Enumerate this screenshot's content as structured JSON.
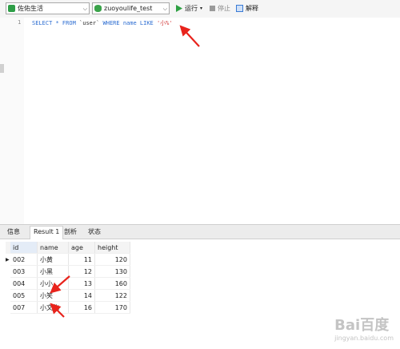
{
  "toolbar": {
    "connection": "佐佑生活",
    "database": "zuoyoulife_test",
    "run_label": "运行",
    "stop_label": "停止",
    "explain_label": "解释",
    "connection_color": "#2e9e47",
    "database_color": "#3aa34a"
  },
  "editor": {
    "line_number": "1",
    "sql": {
      "part1": "SELECT * FROM ",
      "part2": "`user`",
      "part3": " WHERE name LIKE ",
      "part4": "'小%'"
    }
  },
  "results": {
    "tabs": [
      "信息",
      "Result 1",
      "剖析",
      "状态"
    ],
    "active_tab": "Result 1",
    "columns": [
      "id",
      "name",
      "age",
      "height"
    ],
    "rows": [
      [
        "002",
        "小黄",
        "11",
        "120"
      ],
      [
        "003",
        "小黑",
        "12",
        "130"
      ],
      [
        "004",
        "小小",
        "13",
        "160"
      ],
      [
        "005",
        "小笑",
        "14",
        "122"
      ],
      [
        "007",
        "小文化",
        "16",
        "170"
      ]
    ],
    "current_row_marker": "▶"
  },
  "watermark": {
    "brand": "Bai百度",
    "sub": "jingyan.baidu.com"
  },
  "colors": {
    "keyword": "#2b6cd1",
    "string": "#d23a3a",
    "arrow": "#e8231c"
  }
}
